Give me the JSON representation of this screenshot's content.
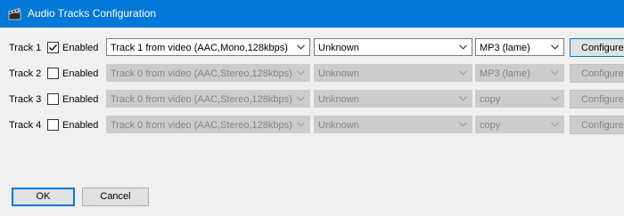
{
  "window": {
    "title": "Audio Tracks Configuration",
    "icon": "clapperboard-icon",
    "accent_color": "#0078d7"
  },
  "tracks": [
    {
      "label": "Track 1",
      "enabled_label": "Enabled",
      "enabled": true,
      "source": "Track 1 from video (AAC,Mono,128kbps)",
      "language": "Unknown",
      "codec": "MP3 (lame)",
      "configure_label": "Configure",
      "disabled": false
    },
    {
      "label": "Track 2",
      "enabled_label": "Enabled",
      "enabled": false,
      "source": "Track 0 from video (AAC,Stereo,128kbps)",
      "language": "Unknown",
      "codec": "MP3 (lame)",
      "configure_label": "Configure",
      "disabled": true
    },
    {
      "label": "Track 3",
      "enabled_label": "Enabled",
      "enabled": false,
      "source": "Track 0 from video (AAC,Stereo,128kbps)",
      "language": "Unknown",
      "codec": "copy",
      "configure_label": "Configure",
      "disabled": true
    },
    {
      "label": "Track 4",
      "enabled_label": "Enabled",
      "enabled": false,
      "source": "Track 0 from video (AAC,Stereo,128kbps)",
      "language": "Unknown",
      "codec": "copy",
      "configure_label": "Configure",
      "disabled": true
    }
  ],
  "buttons": {
    "ok_label": "OK",
    "cancel_label": "Cancel"
  }
}
